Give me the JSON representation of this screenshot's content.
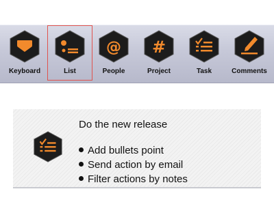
{
  "toolbar": {
    "items": [
      {
        "label": "Keyboard",
        "icon": "keyboard-icon"
      },
      {
        "label": "List",
        "icon": "list-icon",
        "selected": true
      },
      {
        "label": "People",
        "icon": "at-sign-icon"
      },
      {
        "label": "Project",
        "icon": "hash-icon"
      },
      {
        "label": "Task",
        "icon": "checklist-icon"
      },
      {
        "label": "Comments",
        "icon": "pencil-icon"
      }
    ]
  },
  "card": {
    "title": "Do the new release",
    "icon": "checklist-icon",
    "bullets": [
      "Add bullets point",
      "Send action by email",
      "Filter actions by notes"
    ]
  },
  "colors": {
    "accent": "#f28a2c",
    "hex_fill": "#1c1c1c",
    "selection_border": "#e0524d"
  }
}
